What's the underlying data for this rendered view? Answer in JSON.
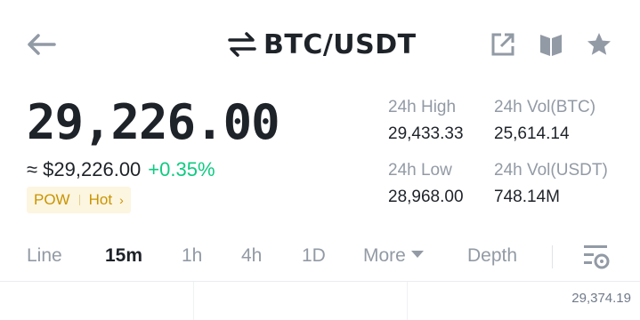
{
  "header": {
    "pair": "BTC/USDT",
    "icons": [
      "back-arrow-icon",
      "swap-icon",
      "share-icon",
      "book-icon",
      "star-icon"
    ]
  },
  "price": {
    "last": "29,226.00",
    "fiat": "≈ $29,226.00",
    "change": "+0.35%"
  },
  "tags": {
    "first": "POW",
    "second": "Hot"
  },
  "stats": {
    "high_label": "24h High",
    "high_value": "29,433.33",
    "vol_btc_label": "24h Vol(BTC)",
    "vol_btc_value": "25,614.14",
    "low_label": "24h Low",
    "low_value": "28,968.00",
    "vol_usdt_label": "24h Vol(USDT)",
    "vol_usdt_value": "748.14M"
  },
  "tabs": {
    "items": [
      "Line",
      "15m",
      "1h",
      "4h",
      "1D",
      "More",
      "Depth"
    ],
    "active": "15m"
  },
  "chart": {
    "top_price_label": "29,374.19"
  },
  "colors": {
    "text": "#1e2329",
    "muted": "#929aa5",
    "up": "#0ecb81",
    "tag_bg": "#fcf5e0",
    "tag_text": "#c99400"
  }
}
